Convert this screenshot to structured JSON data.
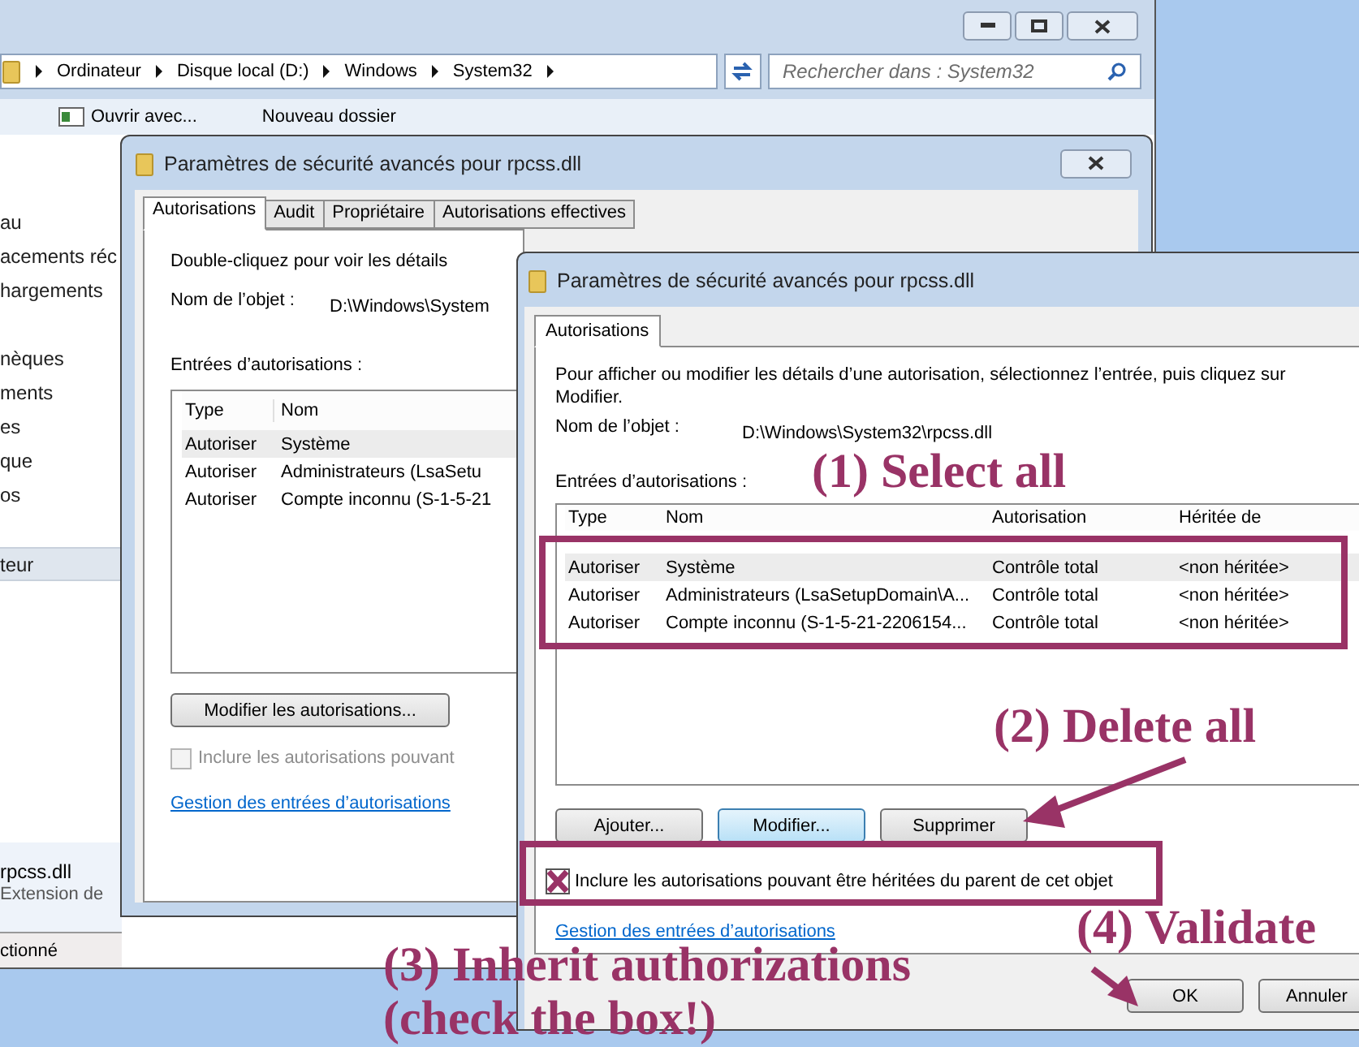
{
  "explorer": {
    "breadcrumb": [
      "Ordinateur",
      "Disque local (D:)",
      "Windows",
      "System32"
    ],
    "search": {
      "placeholder": "Rechercher dans : System32"
    },
    "toolbar": [
      "Ouvrir avec...",
      "Nouveau dossier"
    ],
    "sidebar": [
      {
        "label": "au",
        "selected": false
      },
      {
        "label": "acements réc",
        "selected": false
      },
      {
        "label": "hargements",
        "selected": false
      },
      {
        "label": "nèques",
        "selected": false
      },
      {
        "label": "ments",
        "selected": false
      },
      {
        "label": "es",
        "selected": false
      },
      {
        "label": "que",
        "selected": false
      },
      {
        "label": "os",
        "selected": false
      },
      {
        "label": "teur",
        "selected": true
      }
    ],
    "file": {
      "name": "rpcss.dll",
      "type": "Extension de"
    },
    "status": "ctionné"
  },
  "back_dialog": {
    "title": "Paramètres de sécurité avancés pour rpcss.dll",
    "tabs": [
      {
        "label": "Autorisations",
        "selected": true
      },
      {
        "label": "Audit",
        "selected": false
      },
      {
        "label": "Propriétaire",
        "selected": false
      },
      {
        "label": "Autorisations effectives",
        "selected": false
      }
    ],
    "description": "Double-cliquez pour voir les détails",
    "object_label": "Nom de l’objet :",
    "object_value": "D:\\Windows\\System",
    "entries_label": "Entrées d’autorisations :",
    "columns": [
      "Type",
      "Nom"
    ],
    "rows": [
      {
        "type": "Autoriser",
        "name": "Système",
        "selected": true
      },
      {
        "type": "Autoriser",
        "name": "Administrateurs (LsaSetu",
        "selected": false
      },
      {
        "type": "Autoriser",
        "name": "Compte inconnu (S-1-5-21",
        "selected": false
      }
    ],
    "edit_button": "Modifier les autorisations...",
    "inherit": {
      "label": "Inclure les autorisations pouvant",
      "checked": false,
      "disabled": true
    },
    "link": "Gestion des entrées d’autorisations"
  },
  "front_dialog": {
    "title": "Paramètres de sécurité avancés pour rpcss.dll",
    "tabs": [
      {
        "label": "Autorisations",
        "selected": true
      }
    ],
    "description": "Pour afficher ou modifier les détails d’une autorisation, sélectionnez l’entrée, puis cliquez sur Modifier.",
    "object_label": "Nom de l’objet :",
    "object_value": "D:\\Windows\\System32\\rpcss.dll",
    "entries_label": "Entrées d’autorisations :",
    "columns": [
      "Type",
      "Nom",
      "Autorisation",
      "Héritée de"
    ],
    "rows": [
      {
        "cells": [
          "Autoriser",
          "Système",
          "Contrôle total",
          "<non héritée>"
        ],
        "selected": true
      },
      {
        "cells": [
          "Autoriser",
          "Administrateurs (LsaSetupDomain\\A...",
          "Contrôle total",
          "<non héritée>"
        ],
        "selected": false
      },
      {
        "cells": [
          "Autoriser",
          "Compte inconnu (S-1-5-21-2206154...",
          "Contrôle total",
          "<non héritée>"
        ],
        "selected": false
      }
    ],
    "buttons": [
      {
        "label": "Ajouter...",
        "focused": false
      },
      {
        "label": "Modifier...",
        "focused": true
      },
      {
        "label": "Supprimer",
        "focused": false
      }
    ],
    "inherit": {
      "label": "Inclure les autorisations pouvant être héritées du parent de cet objet",
      "checked": true
    },
    "link": "Gestion des entrées d’autorisations",
    "footer_buttons": [
      "OK",
      "Annuler"
    ]
  },
  "annotations": {
    "select": "(1) Select all",
    "delete": "(2) Delete all",
    "inherit": [
      "(3) Inherit authorizations",
      "(check the box!)"
    ],
    "validate": "(4) Validate"
  }
}
